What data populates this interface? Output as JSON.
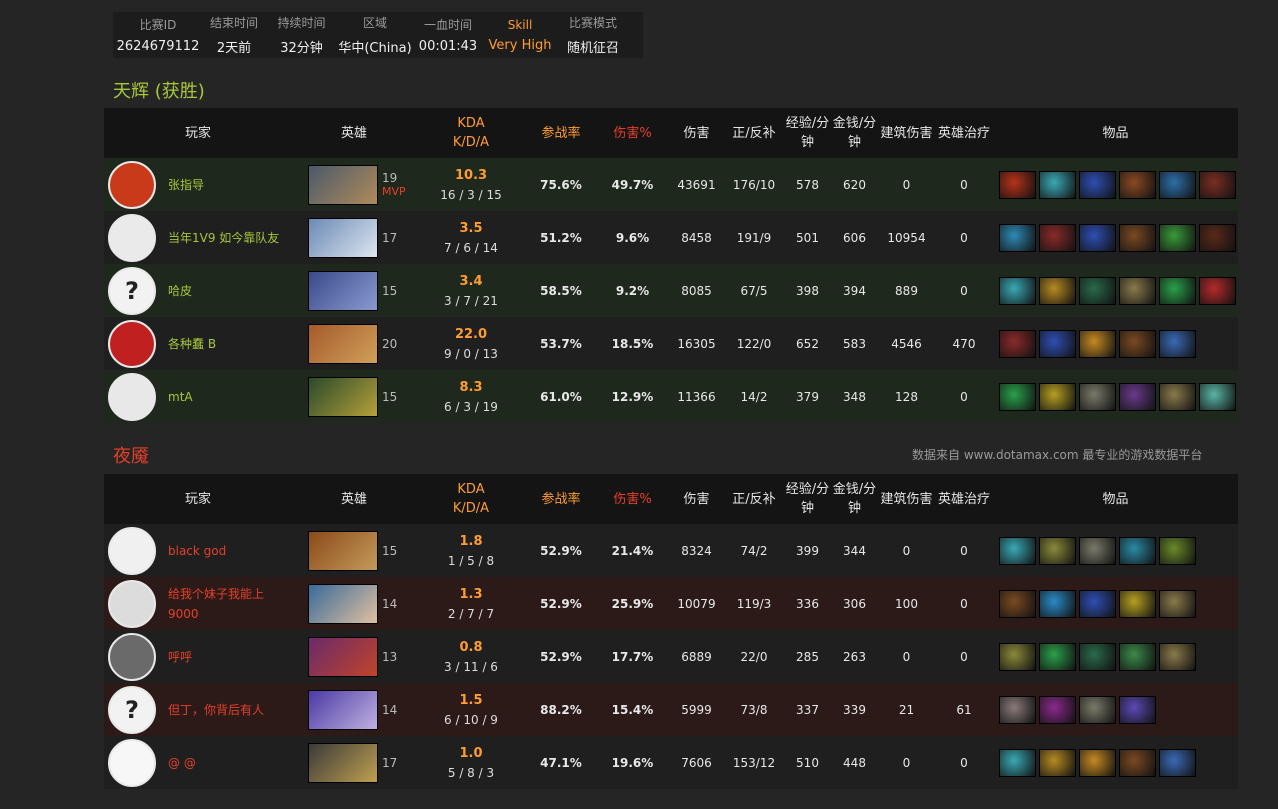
{
  "match": {
    "fields": [
      {
        "label": "比赛ID",
        "value": "2624679112"
      },
      {
        "label": "结束时间",
        "value": "2天前"
      },
      {
        "label": "持续时间",
        "value": "32分钟"
      },
      {
        "label": "区域",
        "value": "华中(China)"
      },
      {
        "label": "一血时间",
        "value": "00:01:43"
      },
      {
        "label": "Skill",
        "value": "Very High"
      },
      {
        "label": "比赛模式",
        "value": "随机征召"
      }
    ]
  },
  "headers": {
    "player": "玩家",
    "hero": "英雄",
    "kda": "KDA",
    "kda_sub": "K/D/A",
    "participation": "参战率",
    "damage_pct": "伤害%",
    "damage": "伤害",
    "lh_dn": "正/反补",
    "xpm": "经验/分钟",
    "gpm": "金钱/分钟",
    "tower": "建筑伤害",
    "heal": "英雄治疗",
    "items": "物品"
  },
  "radiant": {
    "title": "天辉 (获胜)",
    "players": [
      {
        "name": "张指导",
        "level": "19",
        "mvp": "MVP",
        "kda": "10.3",
        "kda_line": "16 / 3 / 15",
        "part": "75.6%",
        "dmg_pct": "49.7%",
        "damage": "43691",
        "lh": "176/10",
        "xpm": "578",
        "gpm": "620",
        "tower": "0",
        "heal": "0",
        "items": [
          "#b53319",
          "#3aa9b5",
          "#2e4fb3",
          "#8a4a22",
          "#2d6fa8",
          "#7a2e22"
        ]
      },
      {
        "name": "当年1V9 如今靠队友",
        "level": "17",
        "mvp": "",
        "kda": "3.5",
        "kda_line": "7 / 6 / 14",
        "part": "51.2%",
        "dmg_pct": "9.6%",
        "damage": "8458",
        "lh": "191/9",
        "xpm": "501",
        "gpm": "606",
        "tower": "10954",
        "heal": "0",
        "items": [
          "#2e8ab5",
          "#8a2a2a",
          "#2e4fb3",
          "#7a4a22",
          "#3a9a3a",
          "#5a2a1a"
        ]
      },
      {
        "name": "哈皮",
        "level": "15",
        "mvp": "",
        "kda": "3.4",
        "kda_line": "3 / 7 / 21",
        "part": "58.5%",
        "dmg_pct": "9.2%",
        "damage": "8085",
        "lh": "67/5",
        "xpm": "398",
        "gpm": "394",
        "tower": "889",
        "heal": "0",
        "items": [
          "#3aa9b5",
          "#b58a22",
          "#2a6a4a",
          "#8a7a4a",
          "#2aa04a",
          "#b52a2a"
        ]
      },
      {
        "name": "各种蠢 B",
        "level": "20",
        "mvp": "",
        "kda": "22.0",
        "kda_line": "9 / 0 / 13",
        "part": "53.7%",
        "dmg_pct": "18.5%",
        "damage": "16305",
        "lh": "122/0",
        "xpm": "652",
        "gpm": "583",
        "tower": "4546",
        "heal": "470",
        "items": [
          "#8a2a2a",
          "#2e4fb3",
          "#c58a22",
          "#7a4a22",
          "#3a6ab5"
        ]
      },
      {
        "name": "mtA",
        "level": "15",
        "mvp": "",
        "kda": "8.3",
        "kda_line": "6 / 3 / 19",
        "part": "61.0%",
        "dmg_pct": "12.9%",
        "damage": "11366",
        "lh": "14/2",
        "xpm": "379",
        "gpm": "348",
        "tower": "128",
        "heal": "0",
        "items": [
          "#2aa04a",
          "#b5a022",
          "#7a7a6a",
          "#6a3a8a",
          "#8a7a4a",
          "#5ab5a5"
        ]
      }
    ]
  },
  "dire": {
    "title": "夜魇",
    "source_note": "数据来自 www.dotamax.com 最专业的游戏数据平台",
    "players": [
      {
        "name": "black god",
        "level": "15",
        "mvp": "",
        "kda": "1.8",
        "kda_line": "1 / 5 / 8",
        "part": "52.9%",
        "dmg_pct": "21.4%",
        "damage": "8324",
        "lh": "74/2",
        "xpm": "399",
        "gpm": "344",
        "tower": "0",
        "heal": "0",
        "items": [
          "#3aa9b5",
          "#8a8a3a",
          "#7a7a6a",
          "#2a8aa5",
          "#6a8a2a"
        ]
      },
      {
        "name": "给我个妹子我能上9000",
        "level": "14",
        "mvp": "",
        "kda": "1.3",
        "kda_line": "2 / 7 / 7",
        "part": "52.9%",
        "dmg_pct": "25.9%",
        "damage": "10079",
        "lh": "119/3",
        "xpm": "336",
        "gpm": "306",
        "tower": "100",
        "heal": "0",
        "items": [
          "#7a4a22",
          "#2a8ac5",
          "#2e4fb3",
          "#b5a022",
          "#8a7a4a"
        ]
      },
      {
        "name": "呼呼",
        "level": "13",
        "mvp": "",
        "kda": "0.8",
        "kda_line": "3 / 11 / 6",
        "part": "52.9%",
        "dmg_pct": "17.7%",
        "damage": "6889",
        "lh": "22/0",
        "xpm": "285",
        "gpm": "263",
        "tower": "0",
        "heal": "0",
        "items": [
          "#8a8a3a",
          "#2aa04a",
          "#2a6a4a",
          "#3a8a4a",
          "#8a7a4a"
        ]
      },
      {
        "name": "但丁，你背后有人",
        "level": "14",
        "mvp": "",
        "kda": "1.5",
        "kda_line": "6 / 10 / 9",
        "part": "88.2%",
        "dmg_pct": "15.4%",
        "damage": "5999",
        "lh": "73/8",
        "xpm": "337",
        "gpm": "339",
        "tower": "21",
        "heal": "61",
        "items": [
          "#8a7a7a",
          "#8a2a8a",
          "#7a7a6a",
          "#5a4ab5"
        ]
      },
      {
        "name": "@ @",
        "level": "17",
        "mvp": "",
        "kda": "1.0",
        "kda_line": "5 / 8 / 3",
        "part": "47.1%",
        "dmg_pct": "19.6%",
        "damage": "7606",
        "lh": "153/12",
        "xpm": "510",
        "gpm": "448",
        "tower": "0",
        "heal": "0",
        "items": [
          "#3aa9b5",
          "#b58a22",
          "#c58a22",
          "#7a4a22",
          "#3a6ab5"
        ]
      }
    ]
  },
  "avatars": {
    "radiant": [
      [
        "#c83a1a",
        "flame-avatar"
      ],
      [
        "#eaeaea",
        "portrait-avatar"
      ],
      [
        "#f2f2f2",
        "question-avatar"
      ],
      [
        "#c02020",
        "dota-logo-avatar"
      ],
      [
        "#e8e8e8",
        "face-avatar"
      ]
    ],
    "dire": [
      [
        "#f0f0f0",
        "stripe-avatar"
      ],
      [
        "#dcdcdc",
        "portrait-avatar"
      ],
      [
        "#6a6a6a",
        "portrait-avatar"
      ],
      [
        "#f2f2f2",
        "question-avatar"
      ],
      [
        "#f7f7f7",
        "cartoon-avatar"
      ]
    ]
  },
  "heroes": {
    "radiant": [
      [
        "#4a5a6a",
        "#b08a5a"
      ],
      [
        "#6a8ab5",
        "#dde6f0"
      ],
      [
        "#3a4a8a",
        "#8a9ad0"
      ],
      [
        "#a55a2a",
        "#d0a05a"
      ],
      [
        "#2a4a2a",
        "#b5a03a"
      ]
    ],
    "dire": [
      [
        "#8a4a1a",
        "#c59a5a"
      ],
      [
        "#3a6a9a",
        "#e0c0a0"
      ],
      [
        "#6a2a6a",
        "#c0442a"
      ],
      [
        "#4a3aa5",
        "#c0b0e0"
      ],
      [
        "#3a3a3a",
        "#c0a050"
      ]
    ]
  }
}
